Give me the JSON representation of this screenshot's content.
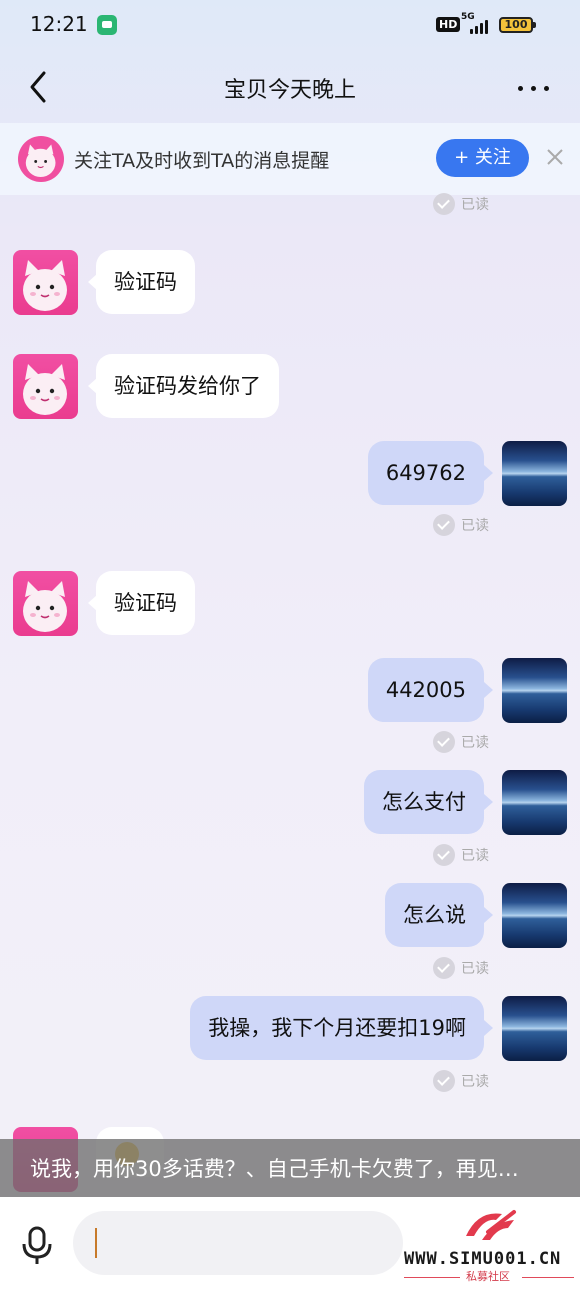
{
  "status_bar": {
    "time": "12:21",
    "network": "5G",
    "hd": "HD",
    "battery": "100"
  },
  "header": {
    "title": "宝贝今天晚上"
  },
  "follow_banner": {
    "text": "关注TA及时收到TA的消息提醒",
    "button": "+ 关注"
  },
  "read_label": "已读",
  "messages": [
    {
      "side": "in",
      "text": "验证码"
    },
    {
      "side": "in",
      "text": "验证码发给你了"
    },
    {
      "side": "out",
      "text": "649762"
    },
    {
      "side": "in",
      "text": "验证码"
    },
    {
      "side": "out",
      "text": "442005"
    },
    {
      "side": "out",
      "text": "怎么支付"
    },
    {
      "side": "out",
      "text": "怎么说"
    },
    {
      "side": "out",
      "text": "我操，我下个月还要扣19啊"
    }
  ],
  "caption": "说我，用你30多话费？、自己手机卡欠费了，再见…",
  "watermark": {
    "url": "WWW.SIMU001.CN",
    "sub": "私募社区"
  },
  "colors": {
    "accent": "#3877f0",
    "outgoing_bubble": "#cfd7f8",
    "avatar_pink": "#f04fa0"
  }
}
